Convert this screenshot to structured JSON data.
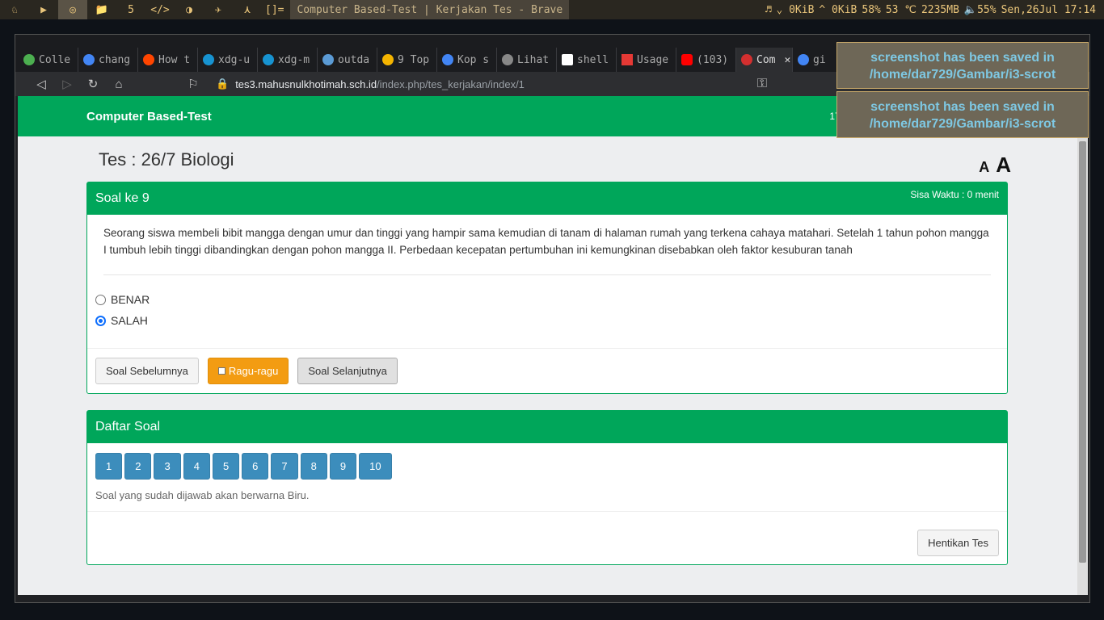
{
  "bar": {
    "workspaces": [
      "♘",
      "▶",
      "◎",
      "📁",
      "5",
      "</>",
      "◑",
      "✈",
      "⋏"
    ],
    "layout": "[]=",
    "title": "Computer Based-Test | Kerjakan Tes - Brave",
    "status": [
      "♬",
      "⌄ 0KiB",
      "^ 0KiB",
      "58%",
      "53 ℃",
      "2235MB",
      "🔈55%",
      "Sen,26Jul 17:14"
    ]
  },
  "browser": {
    "tabs": [
      "Colle",
      "chang",
      "How t",
      "xdg-u",
      "xdg-m",
      "outda",
      "9 Top",
      "Kop s",
      "Lihat",
      "shell",
      "Usage",
      "(103)",
      "Com",
      "gi"
    ],
    "url_host": "tes3.mahusnulkhotimah.sch.id",
    "url_path": "/index.php/tes_kerjakan/index/1"
  },
  "page": {
    "brand": "Computer Based-Test",
    "time": "17.",
    "title": "Tes : 26/7 Biologi",
    "font_small": "A",
    "font_large": "A"
  },
  "question": {
    "header": "Soal ke 9",
    "timer": "Sisa Waktu : 0 menit",
    "text": "Seorang siswa membeli bibit mangga dengan umur dan tinggi yang hampir sama kemudian di tanam di halaman rumah yang terkena cahaya matahari. Setelah 1 tahun pohon mangga I tumbuh lebih tinggi dibandingkan dengan pohon mangga II. Perbedaan kecepatan pertumbuhan ini kemungkinan disebabkan oleh faktor kesuburan tanah",
    "options": [
      "BENAR",
      "SALAH"
    ],
    "selected": "SALAH",
    "prev": "Soal Sebelumnya",
    "doubt": "Ragu-ragu",
    "next": "Soal Selanjutnya"
  },
  "list": {
    "header": "Daftar Soal",
    "numbers": [
      "1",
      "2",
      "3",
      "4",
      "5",
      "6",
      "7",
      "8",
      "9",
      "10"
    ],
    "hint": "Soal yang sudah dijawab akan berwarna Biru.",
    "stop": "Hentikan Tes"
  },
  "notifications": [
    "screenshot has been saved in /home/dar729/Gambar/i3-scrot",
    "screenshot has been saved in /home/dar729/Gambar/i3-scrot"
  ]
}
